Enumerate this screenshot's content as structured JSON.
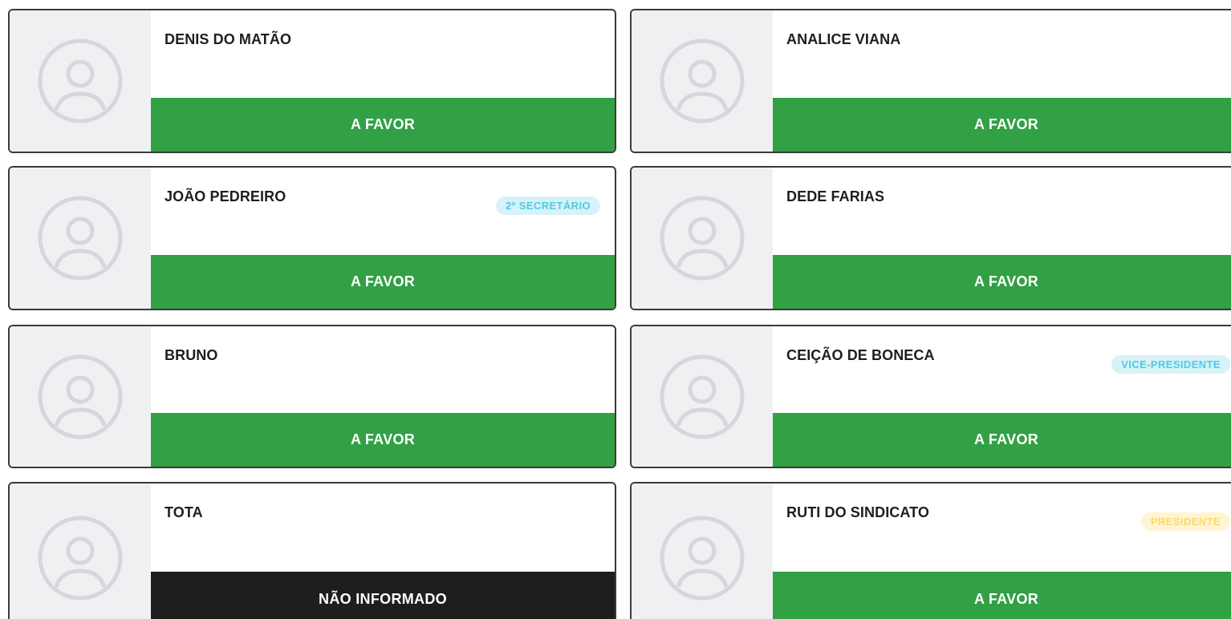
{
  "colors": {
    "favor": "#32a045",
    "not_informed": "#1e1e1e",
    "badge_cyan_bg": "#d7f2f8",
    "badge_cyan_text": "#4fcbe4",
    "badge_yellow_bg": "#fff4d4",
    "badge_yellow_text": "#fdd866",
    "avatar_bg": "#eff0f2",
    "avatar_icon": "#d5d7db"
  },
  "cards": [
    {
      "name": "DENIS DO MATÃO",
      "role": "",
      "vote": "A FAVOR",
      "vote_type": "favor",
      "badge_style": ""
    },
    {
      "name": "ANALICE VIANA",
      "role": "",
      "vote": "A FAVOR",
      "vote_type": "favor",
      "badge_style": ""
    },
    {
      "name": "JOÃO PEDREIRO",
      "role": "2º SECRETÁRIO",
      "vote": "A FAVOR",
      "vote_type": "favor",
      "badge_style": "cyan"
    },
    {
      "name": "DEDE FARIAS",
      "role": "",
      "vote": "A FAVOR",
      "vote_type": "favor",
      "badge_style": ""
    },
    {
      "name": "BRUNO",
      "role": "",
      "vote": "A FAVOR",
      "vote_type": "favor",
      "badge_style": ""
    },
    {
      "name": "CEIÇÃO DE BONECA",
      "role": "VICE-PRESIDENTE",
      "vote": "A FAVOR",
      "vote_type": "favor",
      "badge_style": "cyan"
    },
    {
      "name": "TOTA",
      "role": "",
      "vote": "NÃO INFORMADO",
      "vote_type": "not_informed",
      "badge_style": ""
    },
    {
      "name": "RUTI DO SINDICATO",
      "role": "PRESIDENTE",
      "vote": "A FAVOR",
      "vote_type": "favor",
      "badge_style": "yellow"
    }
  ],
  "icons": {
    "avatar": "user-circle-icon"
  }
}
